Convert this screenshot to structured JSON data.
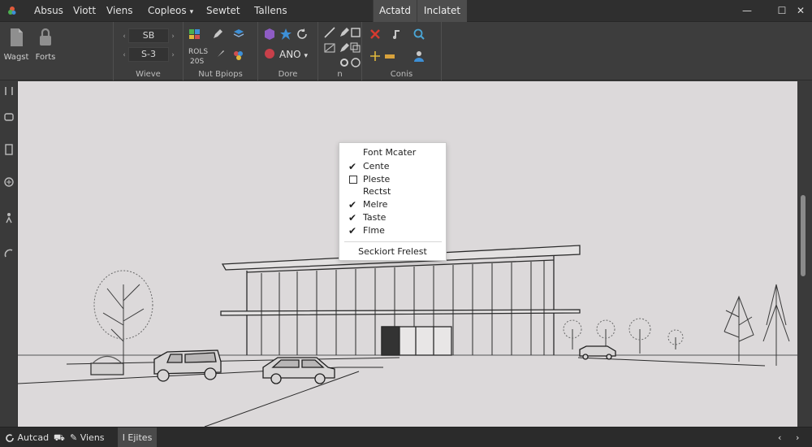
{
  "menu": {
    "items": [
      "Absus",
      "Viott",
      "Viens",
      "Copleos",
      "Sewtet",
      "Tallens"
    ],
    "copleos_has_caret": true,
    "context_tabs": [
      "Actatd",
      "Inclatet"
    ]
  },
  "ribbon": {
    "buttons": {
      "btn1": "Wagst",
      "btn2": "Forts"
    },
    "spinners": {
      "top": "SB",
      "bottom": "S-3"
    },
    "small_text": {
      "a": "ROLS",
      "b": "20S"
    },
    "dropdown": "ANO",
    "groups": {
      "views": "Wieve",
      "nut": "Nut Bpiops",
      "done": "Dore",
      "n": "n",
      "cont": "Conis"
    }
  },
  "context_menu": {
    "header": "Font Mcater",
    "items": [
      {
        "label": "Cente",
        "mark": "check"
      },
      {
        "label": "Pleste",
        "mark": "box"
      },
      {
        "label": "Rectst",
        "mark": "none"
      },
      {
        "label": "Melre",
        "mark": "check"
      },
      {
        "label": "Taste",
        "mark": "check"
      },
      {
        "label": "Flme",
        "mark": "check"
      }
    ],
    "footer": "Seckiort Frelest"
  },
  "statusbar": {
    "app": "Autcad",
    "views": "Viens",
    "active": "I Ejites"
  },
  "colors": {
    "canvas": "#dcd9da",
    "chrome": "#3b3b3b",
    "accent_red": "#d63a2f"
  }
}
